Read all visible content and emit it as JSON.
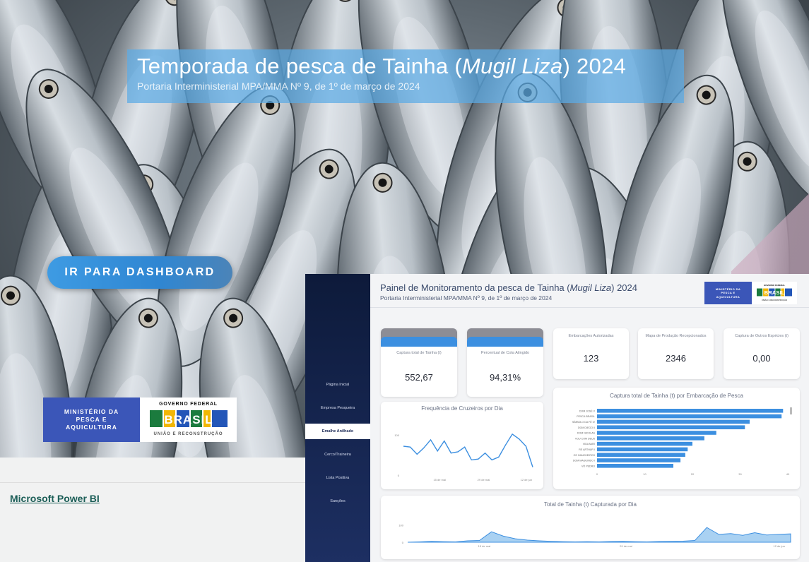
{
  "hero": {
    "title_pre": "Temporada de pesca de Tainha (",
    "title_species": "Mugil Liza",
    "title_post": ") 2024",
    "subtitle": "Portaria Interministerial MPA/MMA Nº 9, de 1º de março de 2024",
    "cta_label": "IR PARA DASHBOARD"
  },
  "logo": {
    "ministry_line1": "MINISTÉRIO DA",
    "ministry_line2": "PESCA E",
    "ministry_line3": "AQUICULTURA",
    "gov_top": "GOVERNO FEDERAL",
    "gov_word": "BRASIL",
    "gov_bottom": "UNIÃO E RECONSTRUÇÃO"
  },
  "footer": {
    "link_label": "Microsoft Power BI"
  },
  "dashboard": {
    "title_pre": "Painel de Monitoramento da pesca de Tainha (",
    "title_species": "Mugil Liza",
    "title_post": ") 2024",
    "subtitle": "Portaria Interministerial MPA/MMA Nº 9, de 1º de março de 2024",
    "mini_logo": {
      "line1": "MINISTÉRIO DA",
      "line2": "PESCA E",
      "line3": "AQUICULTURA",
      "gov_top": "GOVERNO FEDERAL",
      "gov_word": "BRASIL",
      "gov_bottom": "UNIÃO E RECONSTRUÇÃO"
    },
    "nav": [
      {
        "label": "Página Inicial",
        "active": false
      },
      {
        "label": "Empresa Pesqueira",
        "active": false
      },
      {
        "label": "Emalhe Anilhado",
        "active": true
      },
      {
        "label": "Cerco/Traineira",
        "active": false
      },
      {
        "label": "Lista Positiva",
        "active": false
      },
      {
        "label": "Sanções",
        "active": false
      }
    ],
    "kpis": [
      {
        "label": "Captura total de Tainha (t)",
        "value": "552,67"
      },
      {
        "label": "Percentual de Cota Atingido",
        "value": "94,31%"
      },
      {
        "label": "Embarcações Autorizadas",
        "value": "123"
      },
      {
        "label": "Mapa de Produção Recepcionados",
        "value": "2346"
      },
      {
        "label": "Captura de Outros Espécies (t)",
        "value": "0,00"
      }
    ],
    "colors": {
      "accent": "#3c8fe0",
      "sidebar": "#0d1a3a",
      "kpi_header": "#8d8d95"
    }
  },
  "chart_data": [
    {
      "type": "line",
      "title": "Frequência de Cruzeiros por Dia",
      "x_tick_labels": [
        "15 de mai",
        "29 de mai",
        "12 de jun"
      ],
      "y_tick_labels": [
        "0",
        "100"
      ],
      "ylim": [
        0,
        130
      ],
      "values": [
        72,
        70,
        52,
        68,
        88,
        60,
        85,
        55,
        58,
        70,
        38,
        40,
        55,
        38,
        45,
        75,
        102,
        90,
        72,
        20
      ]
    },
    {
      "type": "bar",
      "orientation": "horizontal",
      "title": "Captura total de Tainha (t) por Embarcação de Pesca",
      "categories": [
        "DOM JOSÉ V",
        "PESCA BRASIL",
        "SÍMBOLO DA FÉ IV",
        "DOM DIEGO II",
        "DOM NICOLAS",
        "VOU COM DEUS",
        "VIDA MAR",
        "RE ARTHUR I",
        "OS GANCHEIROS",
        "DOM MAGUINDO I",
        "VÔ PEDRO"
      ],
      "values": [
        39.0,
        38.7,
        32.0,
        31.0,
        25.0,
        22.5,
        20.0,
        19.0,
        18.5,
        17.5,
        16.0
      ],
      "x_tick_labels": [
        "0",
        "10",
        "20",
        "30",
        "40"
      ],
      "xlim": [
        0,
        40
      ]
    },
    {
      "type": "area",
      "title": "Total de Tainha (t) Capturada por Dia",
      "x_tick_labels": [
        "15 de mai",
        "29 de mai",
        "12 de jun"
      ],
      "y_tick_labels": [
        "0",
        "100"
      ],
      "ylim": [
        0,
        130
      ],
      "values": [
        0,
        2,
        5,
        3,
        2,
        8,
        10,
        60,
        35,
        20,
        12,
        8,
        5,
        3,
        2,
        3,
        2,
        4,
        5,
        3,
        2,
        4,
        5,
        6,
        10,
        85,
        45,
        50,
        40,
        55,
        42,
        45,
        48
      ]
    }
  ]
}
